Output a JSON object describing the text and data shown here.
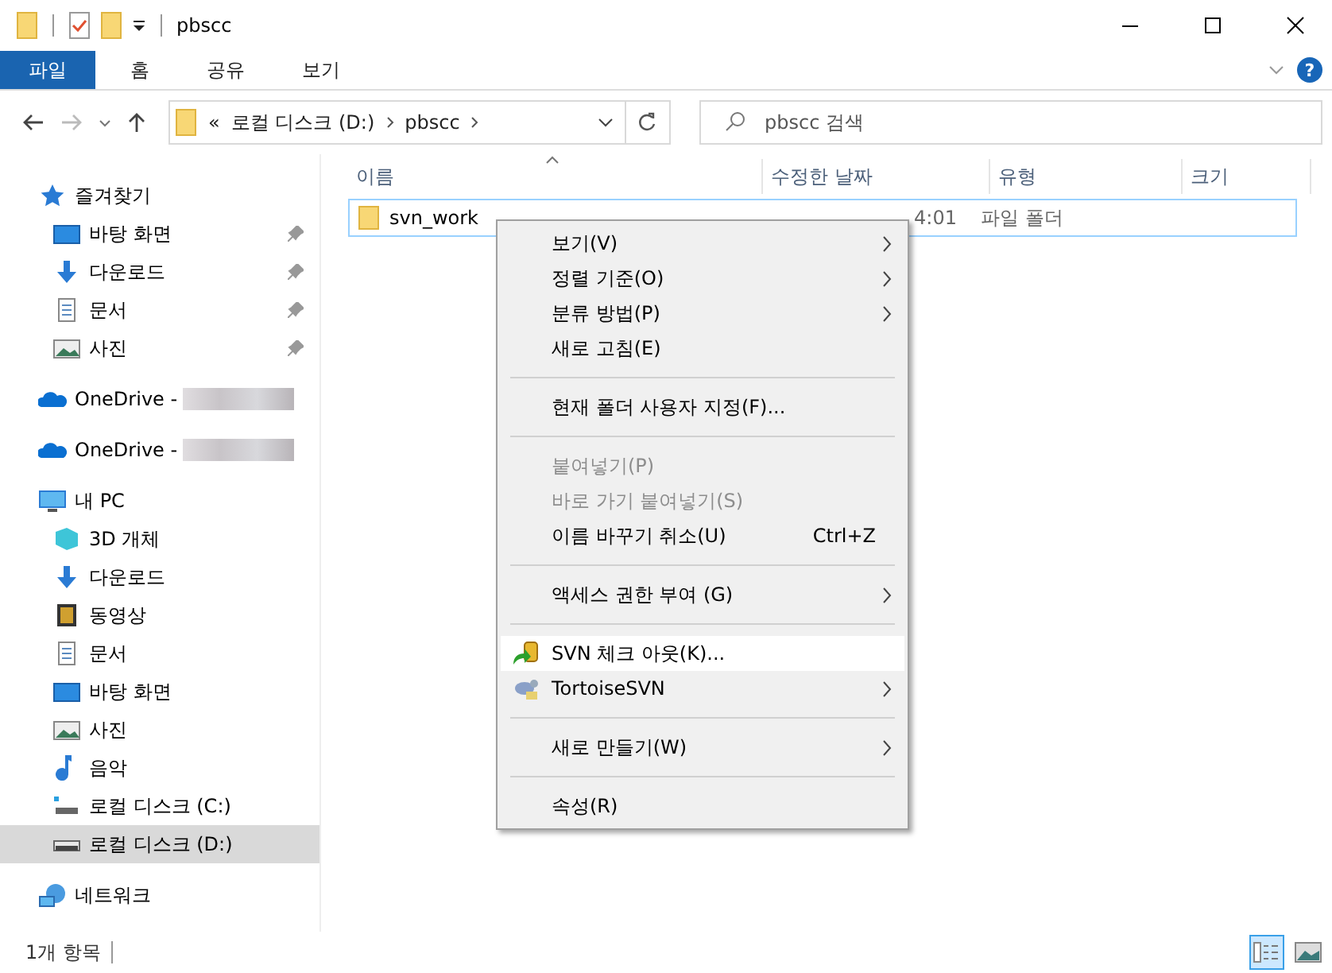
{
  "window": {
    "title": "pbscc"
  },
  "ribbon": {
    "tabs": [
      {
        "label": "파일",
        "selected": true
      },
      {
        "label": "홈",
        "selected": false
      },
      {
        "label": "공유",
        "selected": false
      },
      {
        "label": "보기",
        "selected": false
      }
    ],
    "help_glyph": "?"
  },
  "address_bar": {
    "overflow": "«",
    "crumbs": [
      "로컬 디스크 (D:)",
      "pbscc"
    ]
  },
  "search": {
    "placeholder": "pbscc 검색"
  },
  "sidebar": {
    "items": [
      {
        "label": "즐겨찾기",
        "kind": "star",
        "selected": false,
        "children": [
          {
            "label": "바탕 화면",
            "kind": "desktop",
            "pinned": true,
            "selected": false
          },
          {
            "label": "다운로드",
            "kind": "download",
            "pinned": true,
            "selected": false
          },
          {
            "label": "문서",
            "kind": "document",
            "pinned": true,
            "selected": false
          },
          {
            "label": "사진",
            "kind": "pictures",
            "pinned": true,
            "selected": false
          }
        ]
      },
      {
        "label": "OneDrive -",
        "kind": "cloud",
        "redacted": true,
        "selected": false
      },
      {
        "label": "OneDrive -",
        "kind": "cloud",
        "redacted": true,
        "selected": false
      },
      {
        "label": "내 PC",
        "kind": "pc",
        "selected": false,
        "children": [
          {
            "label": "3D 개체",
            "kind": "cube",
            "selected": false
          },
          {
            "label": "다운로드",
            "kind": "download",
            "selected": false
          },
          {
            "label": "동영상",
            "kind": "video",
            "selected": false
          },
          {
            "label": "문서",
            "kind": "document",
            "selected": false
          },
          {
            "label": "바탕 화면",
            "kind": "desktop",
            "selected": false
          },
          {
            "label": "사진",
            "kind": "pictures",
            "selected": false
          },
          {
            "label": "음악",
            "kind": "music",
            "selected": false
          },
          {
            "label": "로컬 디스크 (C:)",
            "kind": "windrive",
            "selected": false
          },
          {
            "label": "로컬 디스크 (D:)",
            "kind": "drive",
            "selected": true
          }
        ]
      },
      {
        "label": "네트워크",
        "kind": "network",
        "selected": false
      }
    ]
  },
  "table": {
    "columns": [
      "이름",
      "수정한 날짜",
      "유형",
      "크기"
    ],
    "rows": [
      {
        "name": "svn_work",
        "date": "4:01",
        "type": "파일 폴더",
        "selected": true
      }
    ]
  },
  "context_menu": {
    "items": [
      {
        "kind": "item",
        "label": "보기(V)",
        "submenu": true,
        "disabled": false,
        "highlighted": false
      },
      {
        "kind": "item",
        "label": "정렬 기준(O)",
        "submenu": true,
        "disabled": false,
        "highlighted": false
      },
      {
        "kind": "item",
        "label": "분류 방법(P)",
        "submenu": true,
        "disabled": false,
        "highlighted": false
      },
      {
        "kind": "item",
        "label": "새로 고침(E)",
        "submenu": false,
        "disabled": false,
        "highlighted": false
      },
      {
        "kind": "separator"
      },
      {
        "kind": "item",
        "label": "현재 폴더 사용자 지정(F)...",
        "submenu": false,
        "disabled": false,
        "highlighted": false
      },
      {
        "kind": "separator"
      },
      {
        "kind": "item",
        "label": "붙여넣기(P)",
        "submenu": false,
        "disabled": true,
        "highlighted": false
      },
      {
        "kind": "item",
        "label": "바로 가기 붙여넣기(S)",
        "submenu": false,
        "disabled": true,
        "highlighted": false
      },
      {
        "kind": "item",
        "label": "이름 바꾸기 취소(U)",
        "shortcut": "Ctrl+Z",
        "submenu": false,
        "disabled": false,
        "highlighted": false
      },
      {
        "kind": "separator"
      },
      {
        "kind": "item",
        "label": "액세스 권한 부여 (G)",
        "submenu": true,
        "disabled": false,
        "highlighted": false
      },
      {
        "kind": "separator"
      },
      {
        "kind": "checkout",
        "label": "SVN 체크 아웃(K)...",
        "submenu": false,
        "disabled": false,
        "highlighted": true
      },
      {
        "kind": "tortoise",
        "label": "TortoiseSVN",
        "submenu": true,
        "disabled": false,
        "highlighted": false
      },
      {
        "kind": "separator"
      },
      {
        "kind": "item",
        "label": "새로 만들기(W)",
        "submenu": true,
        "disabled": false,
        "highlighted": false
      },
      {
        "kind": "separator"
      },
      {
        "kind": "item",
        "label": "속성(R)",
        "submenu": false,
        "disabled": false,
        "highlighted": false
      }
    ]
  },
  "status_bar": {
    "count": "1개 항목",
    "views": [
      {
        "kind": "details",
        "selected": true
      },
      {
        "kind": "large",
        "selected": false
      }
    ]
  }
}
